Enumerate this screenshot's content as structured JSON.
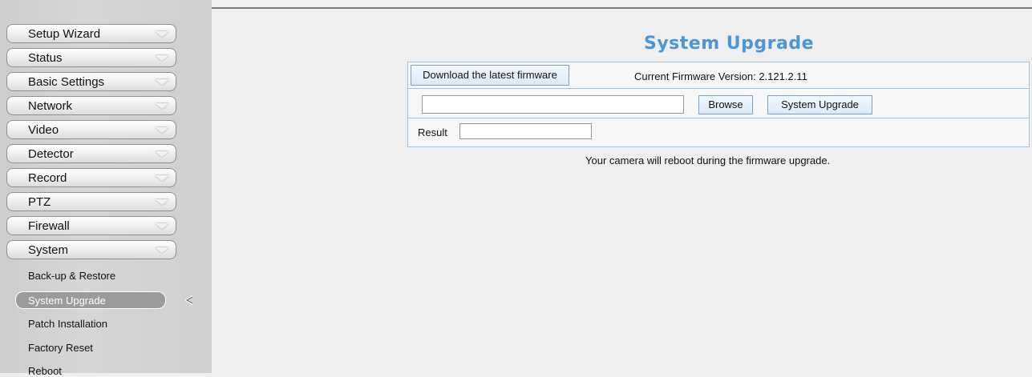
{
  "sidebar": {
    "menu": [
      {
        "label": "Setup Wizard"
      },
      {
        "label": "Status"
      },
      {
        "label": "Basic Settings"
      },
      {
        "label": "Network"
      },
      {
        "label": "Video"
      },
      {
        "label": "Detector"
      },
      {
        "label": "Record"
      },
      {
        "label": "PTZ"
      },
      {
        "label": "Firewall"
      },
      {
        "label": "System"
      }
    ],
    "submenu": [
      {
        "label": "Back-up & Restore"
      },
      {
        "label": "System Upgrade",
        "active": true
      },
      {
        "label": "Patch Installation"
      },
      {
        "label": "Factory Reset"
      },
      {
        "label": "Reboot"
      }
    ]
  },
  "main": {
    "title": "System Upgrade",
    "download_label": "Download the latest firmware",
    "firmware_version_text": "Current Firmware Version: 2.121.2.11",
    "file_value": "",
    "browse_label": "Browse",
    "upgrade_label": "System Upgrade",
    "result_label": "Result",
    "result_value": "",
    "note": "Your camera will reboot during the firmware upgrade."
  },
  "colors": {
    "title": "#4a96d9",
    "table_border": "#9ec3e6",
    "active_submenu": "#9b9b9b"
  }
}
